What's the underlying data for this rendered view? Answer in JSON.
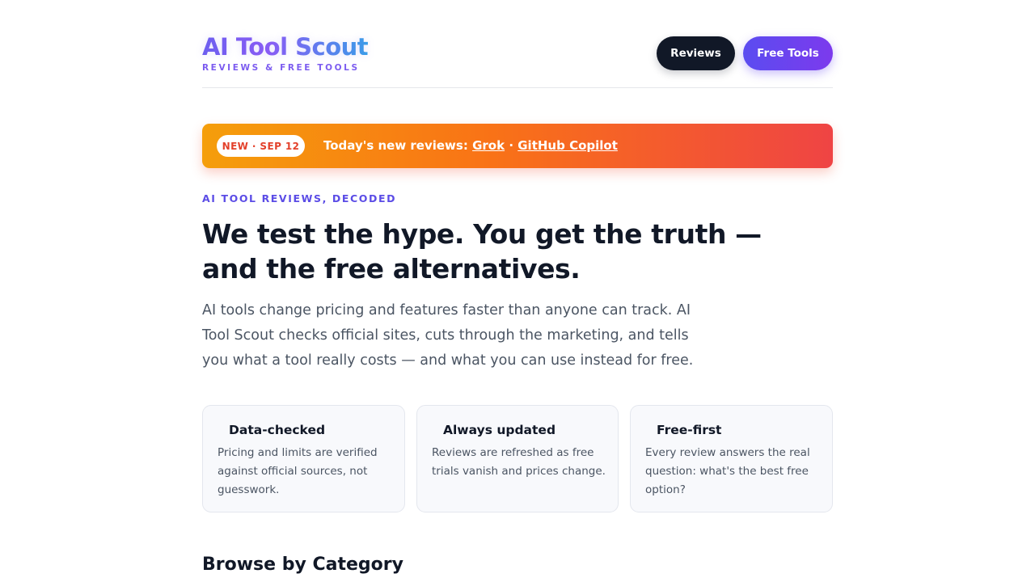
{
  "header": {
    "logo": "AI Tool Scout",
    "tagline": "REVIEWS & FREE TOOLS",
    "nav": {
      "reviews_label": "Reviews",
      "free_tools_label": "Free Tools"
    }
  },
  "banner": {
    "badge": "NEW · SEP 12",
    "prefix": "Today's new reviews:",
    "links": [
      "Grok",
      "GitHub Copilot"
    ],
    "separator": "·"
  },
  "hero": {
    "eyebrow": "AI TOOL REVIEWS, DECODED",
    "headline_line1": "We test the hype. You get the truth —",
    "headline_line2": "and the free alternatives.",
    "lead": "AI tools change pricing and features faster than anyone can track. AI Tool Scout checks official sites, cuts through the marketing, and tells you what a tool really costs — and what you can use instead for free."
  },
  "features": [
    {
      "title": "Data-checked",
      "body": "Pricing and limits are verified against official sources, not guesswork."
    },
    {
      "title": "Always updated",
      "body": "Reviews are refreshed as free trials vanish and prices change."
    },
    {
      "title": "Free-first",
      "body": "Every review answers the real question: what's the best free option?"
    }
  ],
  "sections": {
    "browse_title": "Browse by Category"
  },
  "colors": {
    "accent": "#5b4ce6",
    "dark": "#111827",
    "banner_start": "#f59e0b",
    "banner_end": "#ef4444"
  }
}
